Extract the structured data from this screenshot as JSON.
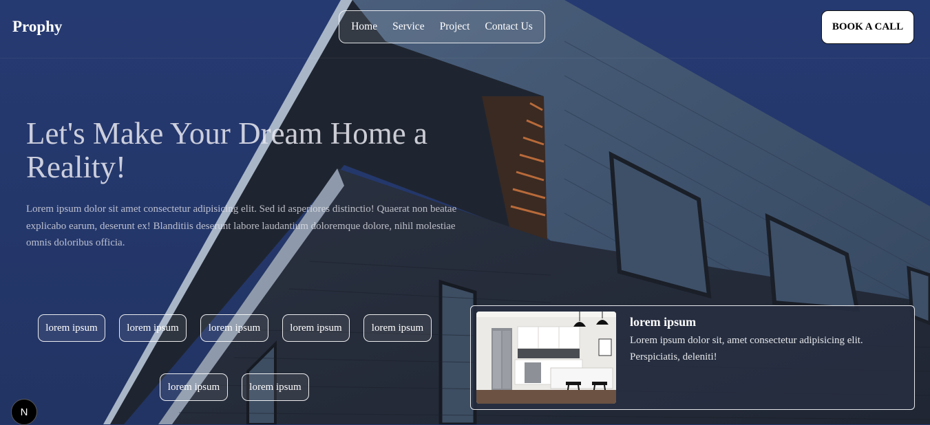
{
  "header": {
    "logo": "Prophy",
    "nav": [
      "Home",
      "Service",
      "Project",
      "Contact Us"
    ],
    "cta": "BOOK A CALL"
  },
  "hero": {
    "title": "Let's Make Your Dream Home a Reality!",
    "description": "Lorem ipsum dolor sit amet consectetur adipisicing elit. Sed id asperiores distinctio! Quaerat non beatae explicabo earum, deserunt ex! Blanditiis deserunt labore laudantium doloremque dolore, nihil molestiae omnis doloribus officia."
  },
  "tags": [
    "lorem ipsum",
    "lorem ipsum",
    "lorem ipsum",
    "lorem ipsum",
    "lorem ipsum",
    "lorem ipsum",
    "lorem ipsum"
  ],
  "card": {
    "title": "lorem ipsum",
    "text": "Lorem ipsum dolor sit, amet consectetur adipisicing elit. Perspiciatis, deleniti!",
    "image_icon": "kitchen-photo"
  },
  "badge": {
    "label": "N"
  },
  "colors": {
    "sky": "#25386e",
    "accent_white": "#ffffff"
  }
}
